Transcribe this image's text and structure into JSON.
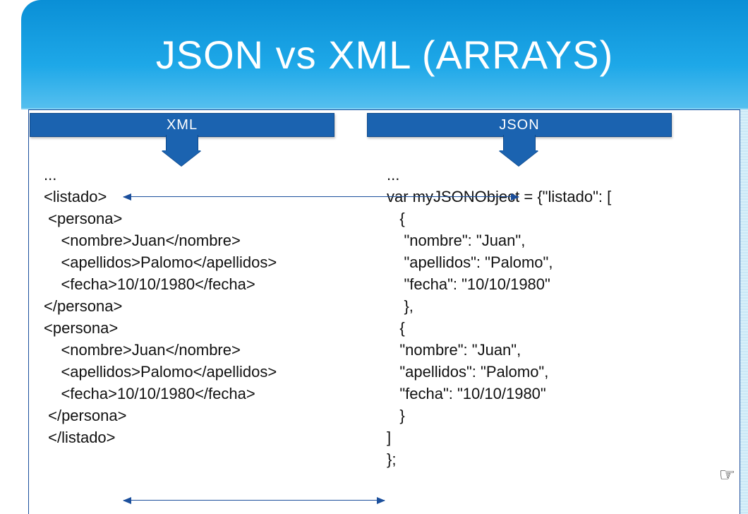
{
  "title": "JSON vs XML (ARRAYS)",
  "labels": {
    "xml": "XML",
    "json": "JSON"
  },
  "code": {
    "xml": "...\n<listado>\n <persona>\n    <nombre>Juan</nombre>\n    <apellidos>Palomo</apellidos>\n    <fecha>10/10/1980</fecha>\n</persona>\n<persona>\n    <nombre>Juan</nombre>\n    <apellidos>Palomo</apellidos>\n    <fecha>10/10/1980</fecha>\n </persona>\n </listado>",
    "json": "...\nvar myJSONObject = {\"listado\": [\n   {\n    \"nombre\": \"Juan\",\n    \"apellidos\": \"Palomo\",\n    \"fecha\": \"10/10/1980\"\n    },\n   {\n   \"nombre\": \"Juan\",\n   \"apellidos\": \"Palomo\",\n   \"fecha\": \"10/10/1980\"\n   }\n]\n};"
  },
  "icon": {
    "hand": "☞"
  }
}
